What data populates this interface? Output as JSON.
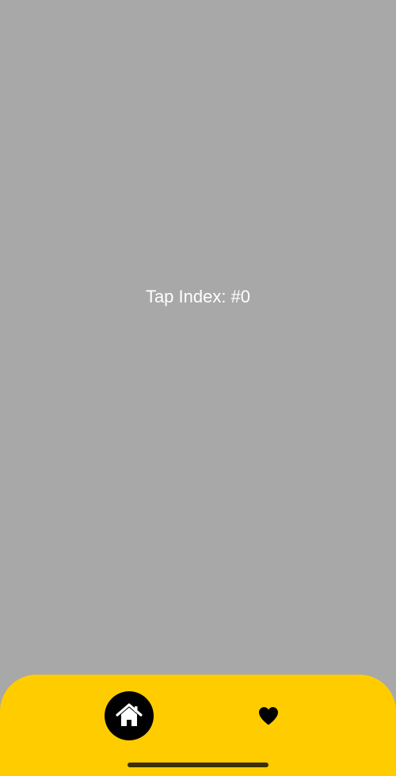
{
  "screen": {
    "background_color": "#a8a8a8",
    "tap_index_text": "Tap Index: #0"
  },
  "bottom_nav": {
    "background_color": "#ffcc00",
    "active_indicator_color": "#000000",
    "items": [
      {
        "icon": "home-icon",
        "selected": true
      },
      {
        "icon": "heart-icon",
        "selected": false
      }
    ]
  }
}
